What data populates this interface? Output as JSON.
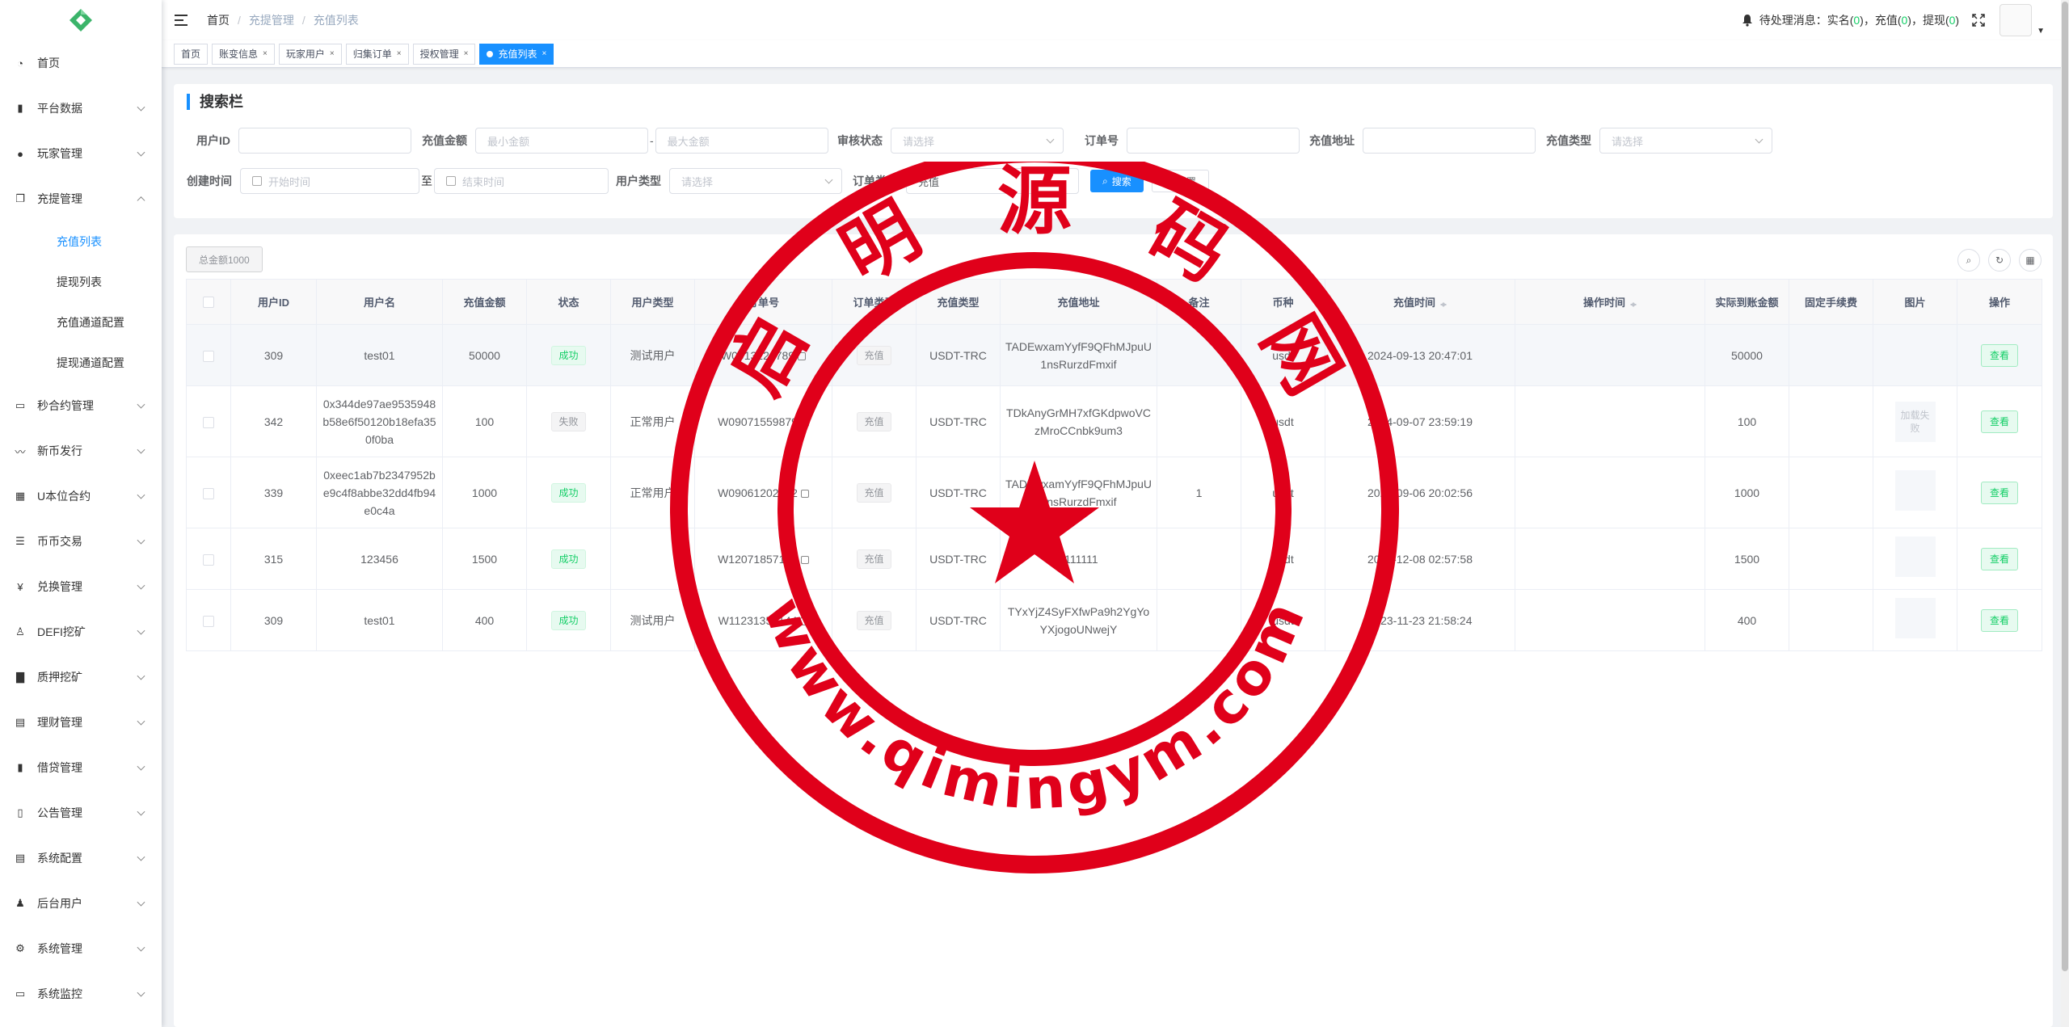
{
  "sidebar": {
    "items": [
      {
        "label": "首页",
        "icon": "dashboard-icon",
        "chev": false
      },
      {
        "label": "平台数据",
        "icon": "data-icon",
        "chev": true
      },
      {
        "label": "玩家管理",
        "icon": "user-icon",
        "chev": true
      },
      {
        "label": "充提管理",
        "icon": "copy-icon",
        "chev": true,
        "open": true
      },
      {
        "label": "秒合约管理",
        "icon": "monitor-icon",
        "chev": true
      },
      {
        "label": "新币发行",
        "icon": "chart-icon",
        "chev": true
      },
      {
        "label": "U本位合约",
        "icon": "table-icon",
        "chev": true
      },
      {
        "label": "币币交易",
        "icon": "list-icon",
        "chev": true
      },
      {
        "label": "兑换管理",
        "icon": "yen-icon",
        "chev": true
      },
      {
        "label": "DEFI挖矿",
        "icon": "person-icon",
        "chev": true
      },
      {
        "label": "质押挖矿",
        "icon": "bar-chart-icon",
        "chev": true
      },
      {
        "label": "理财管理",
        "icon": "wallet-icon",
        "chev": true
      },
      {
        "label": "借贷管理",
        "icon": "loan-icon",
        "chev": true
      },
      {
        "label": "公告管理",
        "icon": "book-icon",
        "chev": true
      },
      {
        "label": "系统配置",
        "icon": "config-icon",
        "chev": true
      },
      {
        "label": "后台用户",
        "icon": "admin-icon",
        "chev": true
      },
      {
        "label": "系统管理",
        "icon": "gear-icon",
        "chev": true
      },
      {
        "label": "系统监控",
        "icon": "monitor-icon",
        "chev": true
      }
    ],
    "sub_items": [
      "充值列表",
      "提现列表",
      "充值通道配置",
      "提现通道配置"
    ]
  },
  "header": {
    "breadcrumb": [
      "首页",
      "充提管理",
      "充值列表"
    ],
    "notice_prefix": "待处理消息：实名(",
    "realname_count": "0",
    "recharge_label": ")，充值(",
    "recharge_count": "0",
    "withdraw_label": ")，提现(",
    "withdraw_count": "0",
    "notice_suffix": ")"
  },
  "tags": [
    "首页",
    "账变信息",
    "玩家用户",
    "归集订单",
    "授权管理",
    "充值列表"
  ],
  "search": {
    "title": "搜索栏",
    "user_id_label": "用户ID",
    "amount_label": "充值金额",
    "min_amount_ph": "最小金额",
    "max_amount_ph": "最大金额",
    "dash": "-",
    "audit_label": "审核状态",
    "audit_ph": "请选择",
    "order_no_label": "订单号",
    "address_label": "充值地址",
    "recharge_type_label": "充值类型",
    "recharge_type_ph": "请选择",
    "create_time_label": "创建时间",
    "start_ph": "开始时间",
    "to": "至",
    "end_ph": "结束时间",
    "user_type_label": "用户类型",
    "user_type_ph": "请选择",
    "order_type_label": "订单类型",
    "order_type_value": "充值",
    "search_btn": "搜索",
    "reset_btn": "重置"
  },
  "table": {
    "total_label": "总金额1000",
    "columns": [
      "",
      "用户ID",
      "用户名",
      "充值金额",
      "状态",
      "用户类型",
      "订单号",
      "订单类型",
      "充值类型",
      "充值地址",
      "备注",
      "币种",
      "充值时间",
      "操作时间",
      "实际到账金额",
      "固定手续费",
      "图片",
      "操作"
    ],
    "rows": [
      {
        "uid": "309",
        "name": "test01",
        "amount": "50000",
        "status": "成功",
        "status_kind": "success",
        "utype": "测试用户",
        "order": "W0913124789",
        "otype": "充值",
        "rtype": "USDT-TRC",
        "address": "TADEwxamYyfF9QFhMJpuU1nsRurzdFmxif",
        "remark": "",
        "coin": "usdt",
        "time": "2024-09-13 20:47:01",
        "optime": "",
        "actual": "50000",
        "fee": "",
        "image": "",
        "action": "查看"
      },
      {
        "uid": "342",
        "name": "0x344de97ae9535948b58e6f50120b18efa350f0ba",
        "amount": "100",
        "status": "失败",
        "status_kind": "info",
        "utype": "正常用户",
        "order": "W09071559879",
        "otype": "充值",
        "rtype": "USDT-TRC",
        "address": "TDkAnyGrMH7xfGKdpwoVCzMroCCnbk9um3",
        "remark": "",
        "coin": "usdt",
        "time": "2024-09-07 23:59:19",
        "optime": "",
        "actual": "100",
        "fee": "",
        "image": "加载失败",
        "action": "查看"
      },
      {
        "uid": "339",
        "name": "0xeec1ab7b2347952be9c4f8abbe32dd4fb94e0c4a",
        "amount": "1000",
        "status": "成功",
        "status_kind": "success",
        "utype": "正常用户",
        "order": "W09061202562",
        "otype": "充值",
        "rtype": "USDT-TRC",
        "address": "TADEwxamYyfF9QFhMJpuU1nsRurzdFmxif",
        "remark": "1",
        "coin": "usdt",
        "time": "2024-09-06 20:02:56",
        "optime": "",
        "actual": "1000",
        "fee": "",
        "image": "",
        "action": "查看"
      },
      {
        "uid": "315",
        "name": "123456",
        "amount": "1500",
        "status": "成功",
        "status_kind": "success",
        "utype": "",
        "order": "W12071857130",
        "otype": "充值",
        "rtype": "USDT-TRC",
        "address": "1111111",
        "remark": "",
        "coin": "usdt",
        "time": "2023-12-08 02:57:58",
        "optime": "",
        "actual": "1500",
        "fee": "",
        "image": "",
        "action": "查看"
      },
      {
        "uid": "309",
        "name": "test01",
        "amount": "400",
        "status": "成功",
        "status_kind": "success",
        "utype": "测试用户",
        "order": "W11231358144",
        "otype": "充值",
        "rtype": "USDT-TRC",
        "address": "TYxYjZ4SyFXfwPa9h2YgYoYXjogoUNwejY",
        "remark": "",
        "coin": "usdt",
        "time": "2023-11-23 21:58:24",
        "optime": "",
        "actual": "400",
        "fee": "",
        "image": "",
        "action": "查看"
      }
    ]
  },
  "watermark": {
    "chars": [
      "启",
      "明",
      "源",
      "码",
      "网"
    ],
    "url": "www.qimingym.com",
    "color": "#e0001a"
  }
}
